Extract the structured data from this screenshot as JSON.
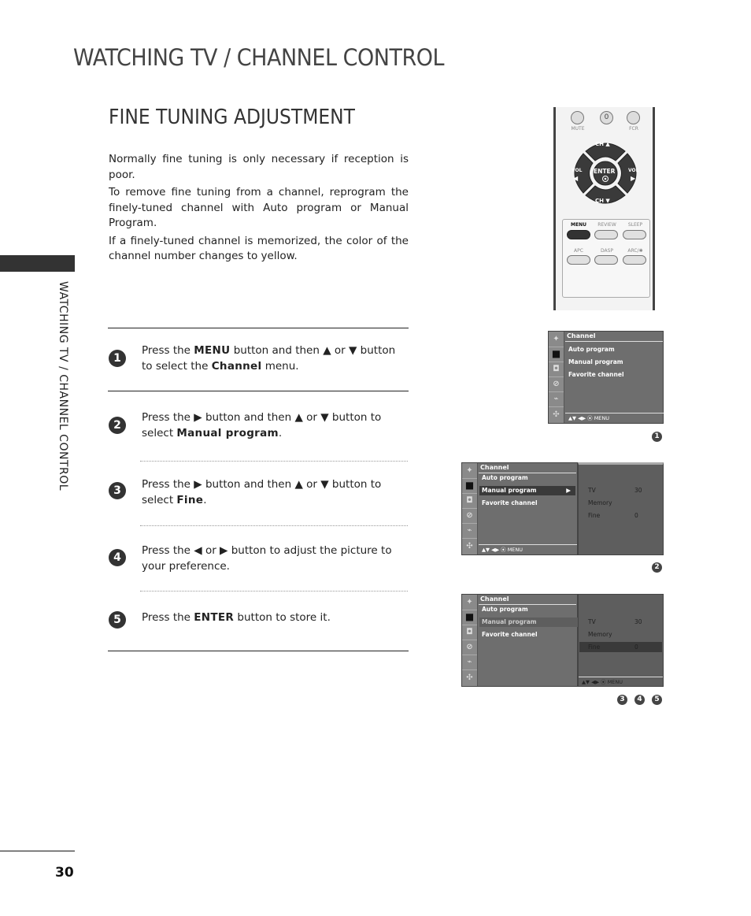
{
  "page": {
    "header_title": "WATCHING TV / CHANNEL CONTROL",
    "section_title": "FINE TUNING ADJUSTMENT",
    "side_label": "WATCHING TV / CHANNEL CONTROL",
    "page_number": "30"
  },
  "intro": {
    "p1": "Normally fine tuning is only necessary if reception is poor.",
    "p2": "To remove fine tuning from a channel, reprogram the finely-tuned channel with Auto program or Manual Program.",
    "p3": "If a finely-tuned channel is memorized, the color of the channel number changes to yellow."
  },
  "steps": [
    {
      "num": "1",
      "pre": "Press the ",
      "bold1": "MENU",
      "mid": " button and then ▲ or ▼ button to select the ",
      "bold2": "Channel",
      "post": " menu."
    },
    {
      "num": "2",
      "pre": "Press the ▶ button and then ▲ or ▼ button to select ",
      "bold1": "Manual program",
      "post": "."
    },
    {
      "num": "3",
      "pre": "Press the ▶ button and then ▲ or ▼ button to select ",
      "bold1": "Fine",
      "post": "."
    },
    {
      "num": "4",
      "pre": "Press the ◀ or ▶ button to adjust the picture to your preference."
    },
    {
      "num": "5",
      "pre": "Press the ",
      "bold1": "ENTER",
      "post": " button to store it."
    }
  ],
  "remote": {
    "mute": "MUTE",
    "zero": "0",
    "fcr": "FCR",
    "ch_up": "CH ▲",
    "ch_down": "CH ▼",
    "vol_left": "VOL",
    "vol_right": "VOL",
    "enter": "ENTER",
    "menu": "MENU",
    "review": "REVIEW",
    "sleep": "SLEEP",
    "apc": "APC",
    "dasp": "DASP",
    "arc": "ARC/✱"
  },
  "osd": {
    "title": "Channel",
    "items": [
      "Auto program",
      "Manual program",
      "Favorite channel"
    ],
    "footer": "▲▼  ◀▶  ⦿  MENU",
    "submenu": [
      {
        "label": "TV",
        "value": "30"
      },
      {
        "label": "Memory",
        "value": ""
      },
      {
        "label": "Fine",
        "value": "0"
      }
    ],
    "arrow": "▶",
    "markers": {
      "screen1": [
        "1"
      ],
      "screen2": [
        "2"
      ],
      "screen3": [
        "3",
        "4",
        "5"
      ]
    }
  }
}
